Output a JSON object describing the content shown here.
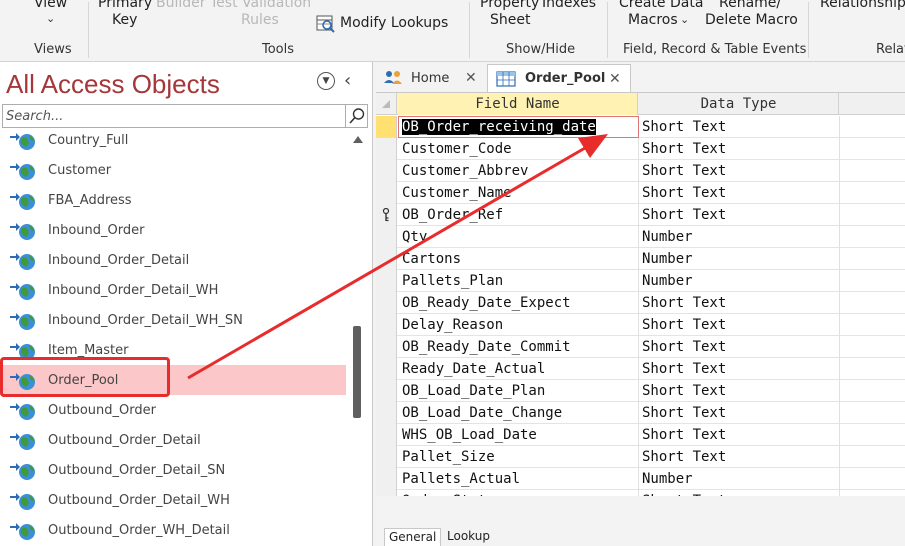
{
  "ribbon": {
    "view_label": "View",
    "primary_key_label_1": "Primary",
    "primary_key_label_2": "Key",
    "builder_label": "Builder",
    "test_rules_label_1": "Test Validation",
    "test_rules_label_2": "Rules",
    "modify_lookups_label": "Modify Lookups",
    "property_sheet_label_1": "Property",
    "property_sheet_label_2": "Sheet",
    "indexes_label": "Indexes",
    "create_macros_label_1": "Create Data",
    "create_macros_label_2": "Macros",
    "rename_macro_label_1": "Rename/",
    "rename_macro_label_2": "Delete Macro",
    "relationships_label": "Relationships",
    "groups": {
      "views": "Views",
      "tools": "Tools",
      "show_hide": "Show/Hide",
      "events": "Field, Record & Table Events",
      "relationships": "Relat"
    }
  },
  "nav": {
    "title": "All Access Objects",
    "search_placeholder": "Search...",
    "items": [
      {
        "label": "Country_Full"
      },
      {
        "label": "Customer"
      },
      {
        "label": "FBA_Address"
      },
      {
        "label": "Inbound_Order"
      },
      {
        "label": "Inbound_Order_Detail"
      },
      {
        "label": "Inbound_Order_Detail_WH"
      },
      {
        "label": "Inbound_Order_Detail_WH_SN"
      },
      {
        "label": "Item_Master"
      },
      {
        "label": "Order_Pool"
      },
      {
        "label": "Outbound_Order"
      },
      {
        "label": "Outbound_Order_Detail"
      },
      {
        "label": "Outbound_Order_Detail_SN"
      },
      {
        "label": "Outbound_Order_Detail_WH"
      },
      {
        "label": "Outbound_Order_WH_Detail"
      }
    ],
    "selected_index": 8
  },
  "tabs": {
    "home_label": "Home",
    "order_pool_label": "Order_Pool"
  },
  "grid": {
    "headers": {
      "field_name": "Field Name",
      "data_type": "Data Type"
    },
    "rows": [
      {
        "field": "OB_Order_receiving_date",
        "type": "Short Text"
      },
      {
        "field": "Customer_Code",
        "type": "Short Text"
      },
      {
        "field": "Customer_Abbrev",
        "type": "Short Text"
      },
      {
        "field": "Customer_Name",
        "type": "Short Text"
      },
      {
        "field": "OB_Order_Ref",
        "type": "Short Text"
      },
      {
        "field": "Qty",
        "type": "Number"
      },
      {
        "field": "Cartons",
        "type": "Number"
      },
      {
        "field": "Pallets_Plan",
        "type": "Number"
      },
      {
        "field": "OB_Ready_Date_Expect",
        "type": "Short Text"
      },
      {
        "field": "Delay_Reason",
        "type": "Short Text"
      },
      {
        "field": "OB_Ready_Date_Commit",
        "type": "Short Text"
      },
      {
        "field": "Ready_Date_Actual",
        "type": "Short Text"
      },
      {
        "field": "OB_Load_Date_Plan",
        "type": "Short Text"
      },
      {
        "field": "OB_Load_Date_Change",
        "type": "Short Text"
      },
      {
        "field": "WHS_OB_Load_Date",
        "type": "Short Text"
      },
      {
        "field": "Pallet_Size",
        "type": "Short Text"
      },
      {
        "field": "Pallets_Actual",
        "type": "Number"
      },
      {
        "field": "Order_Status",
        "type": "Short Text"
      }
    ],
    "current_row": 0,
    "key_row": 4
  },
  "bottom_tabs": {
    "general_label": "General",
    "lookup_label": "Lookup"
  },
  "colors": {
    "title_red": "#a4373a",
    "selection_pink": "#fbc7c8",
    "annotation_red": "#e82c2c",
    "header_yellow": "#fff2b3"
  }
}
